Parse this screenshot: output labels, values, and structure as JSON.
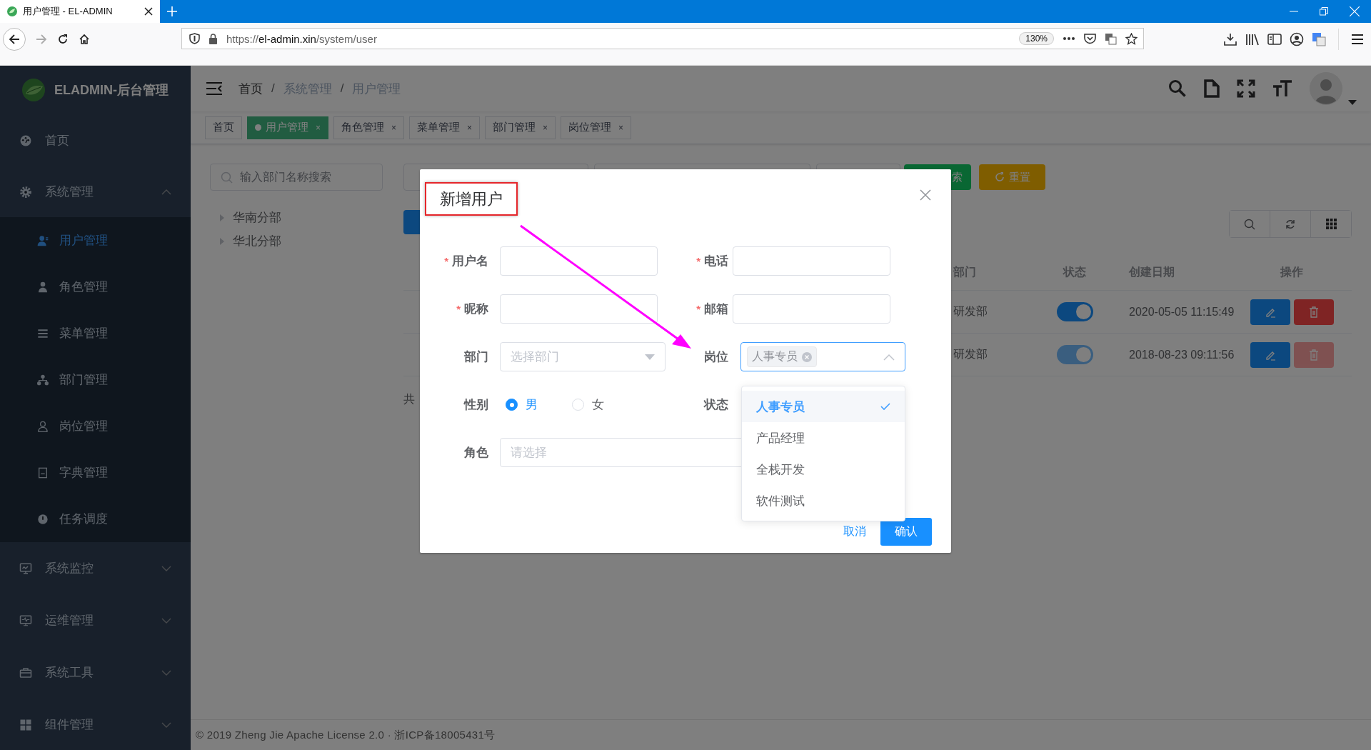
{
  "browser": {
    "tab_title": "用户管理 - EL-ADMIN",
    "url_scheme": "https://",
    "url_host": "el-admin.xin",
    "url_path": "/system/user",
    "zoom": "130%"
  },
  "sidebar": {
    "logo_text": "ELADMIN-后台管理",
    "menu": [
      {
        "label": "首页",
        "kind": "link",
        "selected": false
      },
      {
        "label": "系统管理",
        "kind": "group",
        "selected": false,
        "expanded": true,
        "children": [
          {
            "label": "用户管理",
            "selected": true
          },
          {
            "label": "角色管理",
            "selected": false
          },
          {
            "label": "菜单管理",
            "selected": false
          },
          {
            "label": "部门管理",
            "selected": false
          },
          {
            "label": "岗位管理",
            "selected": false
          },
          {
            "label": "字典管理",
            "selected": false
          },
          {
            "label": "任务调度",
            "selected": false
          }
        ]
      },
      {
        "label": "系统监控",
        "kind": "group",
        "selected": false,
        "expanded": false
      },
      {
        "label": "运维管理",
        "kind": "group",
        "selected": false,
        "expanded": false
      },
      {
        "label": "系统工具",
        "kind": "group",
        "selected": false,
        "expanded": false
      },
      {
        "label": "组件管理",
        "kind": "group",
        "selected": false,
        "expanded": false
      }
    ]
  },
  "breadcrumb": [
    {
      "label": "首页",
      "separator": "/"
    },
    {
      "label": "系统管理",
      "separator": "/"
    },
    {
      "label": "用户管理"
    }
  ],
  "tags": [
    {
      "label": "首页",
      "selected": false
    },
    {
      "label": "用户管理",
      "selected": true,
      "close": "×"
    },
    {
      "label": "角色管理",
      "selected": false,
      "close": "×"
    },
    {
      "label": "菜单管理",
      "selected": false,
      "close": "×"
    },
    {
      "label": "部门管理",
      "selected": false,
      "close": "×"
    },
    {
      "label": "岗位管理",
      "selected": false,
      "close": "×"
    }
  ],
  "dept_search": {
    "placeholder": "输入部门名称搜索"
  },
  "dept_tree": [
    {
      "label": "华南分部",
      "expanded": false
    },
    {
      "label": "华北分部",
      "expanded": false
    }
  ],
  "toolbar": {
    "search_button": "索",
    "reset_button": "重置"
  },
  "table": {
    "columns": [
      "部门",
      "状态",
      "创建日期",
      "操作"
    ],
    "rows": [
      {
        "dept": "研发部",
        "enabled": true,
        "switch_disabled": false,
        "created": "2020-05-05 11:15:49",
        "delete_disabled": false
      },
      {
        "dept": "研发部",
        "enabled": true,
        "switch_disabled": true,
        "created": "2018-08-23 09:11:56",
        "delete_disabled": true
      }
    ]
  },
  "pagination_text": "共",
  "dialog": {
    "title": "新增用户",
    "title_highlighted": true,
    "fields": [
      {
        "label": "用户名",
        "required_mark": "*",
        "kind": "input"
      },
      {
        "label": "电话",
        "required_mark": "*",
        "kind": "input"
      },
      {
        "label": "昵称",
        "required_mark": "*",
        "kind": "input"
      },
      {
        "label": "邮箱",
        "required_mark": "*",
        "kind": "input"
      },
      {
        "label": "部门",
        "kind": "select",
        "placeholder": "选择部门"
      },
      {
        "label": "岗位",
        "kind": "multiselect",
        "focused": true,
        "tags": [
          "人事专员"
        ]
      },
      {
        "label": "性别",
        "kind": "radio",
        "options": [
          {
            "label": "男",
            "selected": true
          },
          {
            "label": "女",
            "selected": false
          }
        ]
      },
      {
        "label": "状态",
        "kind": "radio"
      },
      {
        "label": "角色",
        "kind": "select",
        "placeholder": "请选择"
      }
    ],
    "dropdown": [
      {
        "label": "人事专员",
        "selected": true
      },
      {
        "label": "产品经理",
        "selected": false
      },
      {
        "label": "全栈开发",
        "selected": false
      },
      {
        "label": "软件测试",
        "selected": false
      }
    ],
    "cancel_button": "取消",
    "confirm_button": "确认"
  },
  "footer": "© 2019 Zheng Jie Apache License 2.0 · 浙ICP备18005431号"
}
